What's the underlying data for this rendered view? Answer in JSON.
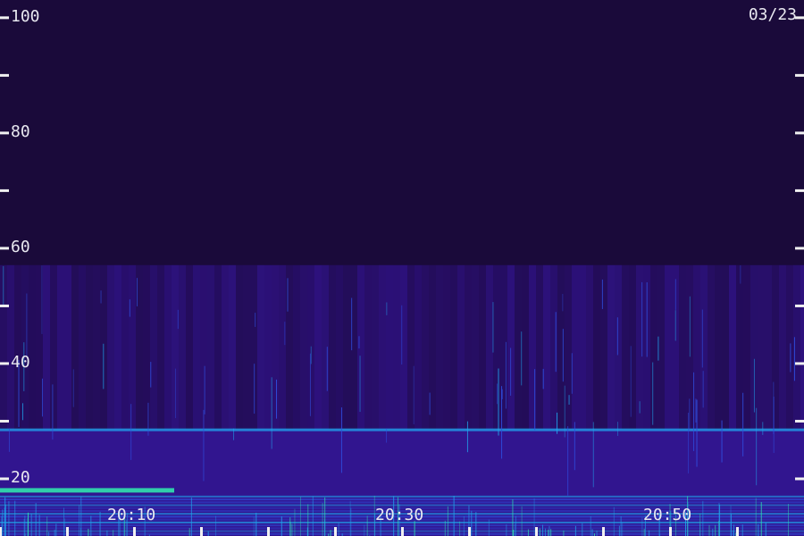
{
  "date_label": "03/23",
  "chart_data": {
    "type": "heatmap",
    "title": "",
    "xlabel": "",
    "ylabel": "",
    "x_range": [
      "20:00",
      "21:00"
    ],
    "x_ticks": [
      "20:10",
      "20:30",
      "20:50"
    ],
    "x_minor_ticks": [
      "20:00",
      "20:05",
      "20:10",
      "20:15",
      "20:20",
      "20:25",
      "20:30",
      "20:35",
      "20:40",
      "20:45",
      "20:50",
      "20:55"
    ],
    "ylim": [
      10,
      103
    ],
    "y_ticks": [
      100,
      80,
      60,
      40,
      20
    ],
    "y_minor_ticks": [
      90,
      70,
      50,
      30
    ],
    "grid": false,
    "colormap": [
      "#1a0a3a",
      "#2a0f6e",
      "#3a1bb0",
      "#2f4fe0",
      "#20a8f0",
      "#30f0b0"
    ],
    "features": {
      "background_noise_upper_limit": 57,
      "persistent_line": 28.5,
      "strong_band": {
        "y": 18,
        "x_end": "20:13"
      },
      "dense_band_below": 17
    }
  }
}
